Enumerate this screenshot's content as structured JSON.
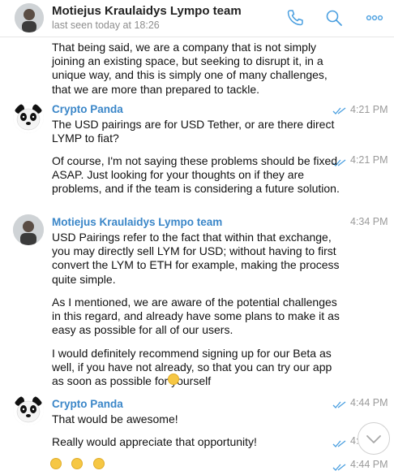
{
  "header": {
    "title": "Motiejus Kraulaidys Lympo team",
    "subtitle": "last seen today at 18:26",
    "icons": [
      "phone-icon",
      "search-icon",
      "more-icon"
    ]
  },
  "messages": {
    "m0": {
      "text": "That being said, we are a company that is not simply joining an existing space, but seeking to disrupt it, in a unique way, and this is simply one of many challenges, that we are more than prepared to tackle."
    },
    "m1": {
      "sender": "Crypto Panda",
      "time": "4:21 PM",
      "text": "The USD pairings are for USD Tether, or are there direct LYMP to fiat?"
    },
    "m2": {
      "time": "4:21 PM",
      "text": "Of course, I'm not saying these problems should be fixed ASAP. Just looking for your thoughts on if they are problems, and if the team is considering a future solution."
    },
    "m3": {
      "sender": "Motiejus Kraulaidys Lympo team",
      "time": "4:34 PM",
      "text": "USD Pairings refer to the fact that within that exchange, you may directly sell LYM for USD; without having to first convert the LYM to ETH for example, making the process quite simple."
    },
    "m4": {
      "text": "As I mentioned, we are aware of the potential challenges in this regard, and already have some plans to make it as easy as possible for all of our users."
    },
    "m5": {
      "text": "I would definitely recommend signing up for our Beta as well, if you have not already, so that you can try our app as soon as possible for yourself"
    },
    "m6": {
      "sender": "Crypto Panda",
      "time": "4:44 PM",
      "text": "That would be awesome!"
    },
    "m7": {
      "time": "4:4",
      "text": "Really would appreciate that opportunity!"
    },
    "m8": {
      "time": "4:44 PM"
    }
  },
  "colors": {
    "sender": "#3a86c8",
    "ticks": "#4a9fe0",
    "time": "#9a9a9a",
    "icons": "#4a9fe0"
  }
}
